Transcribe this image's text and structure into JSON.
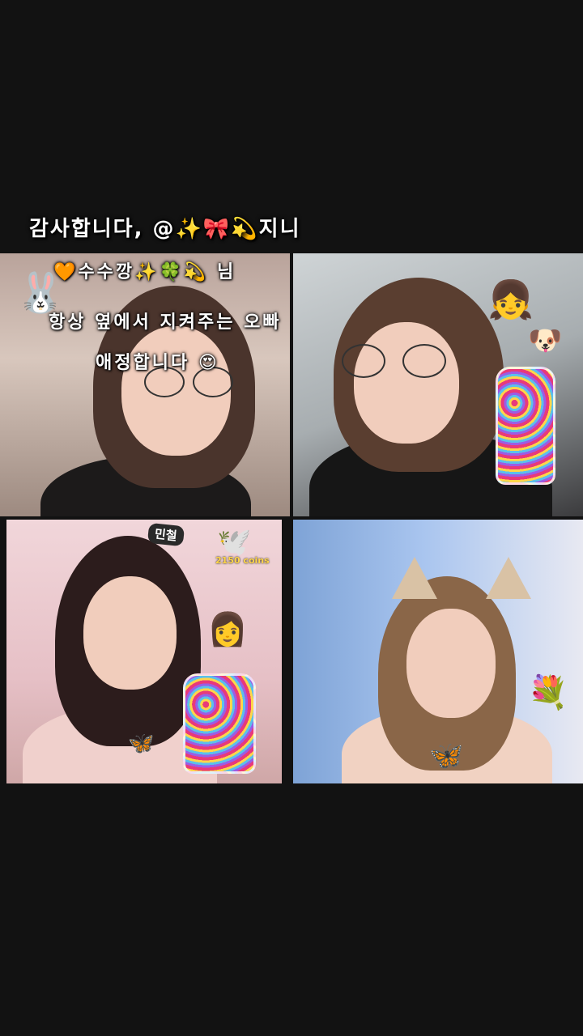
{
  "caption": {
    "text": "감사합니다, @✨🎀💫지니"
  },
  "overlay": {
    "line1": "🧡수수깡✨🍀💫 님",
    "line2": "항상 옆에서 지켜주는 오빠",
    "line3": "애정합니다 😍"
  },
  "tiles": [
    {
      "name": "tile-top-left"
    },
    {
      "name": "tile-top-right"
    },
    {
      "name": "tile-bottom-left",
      "badge": "민철",
      "coins": "2150 coins"
    },
    {
      "name": "tile-bottom-right"
    }
  ],
  "colors": {
    "background": "#121212",
    "caption_text": "#ffffff",
    "coin_text": "#ffd54a"
  }
}
